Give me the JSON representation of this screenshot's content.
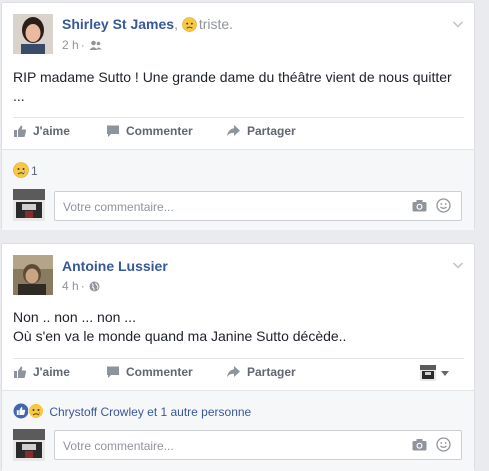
{
  "posts": [
    {
      "author": "Shirley St James",
      "feeling_text": "triste.",
      "time": "2 h",
      "audience_icon": "friends-icon",
      "text_line1": "RIP madame Sutto ! Une grande dame du théâtre vient de nous quitter",
      "text_line2": "...",
      "actions": {
        "like": "J'aime",
        "comment": "Commenter",
        "share": "Partager"
      },
      "reaction_count": "1",
      "comment_placeholder": "Votre commentaire..."
    },
    {
      "author": "Antoine Lussier",
      "time": "4 h",
      "audience_icon": "globe-icon",
      "text_line1": "Non .. non ... non ...",
      "text_line2": "Où s'en va le monde quand ma Janine Sutto décède..",
      "actions": {
        "like": "J'aime",
        "comment": "Commenter",
        "share": "Partager"
      },
      "reactions_text": "Chrystoff Crowley et 1 autre personne",
      "comment_placeholder": "Votre commentaire..."
    }
  ],
  "colors": {
    "link": "#365899",
    "muted": "#90949c",
    "action": "#606770",
    "like_blue": "#4267b2",
    "sad_yellow": "#f7c846"
  }
}
